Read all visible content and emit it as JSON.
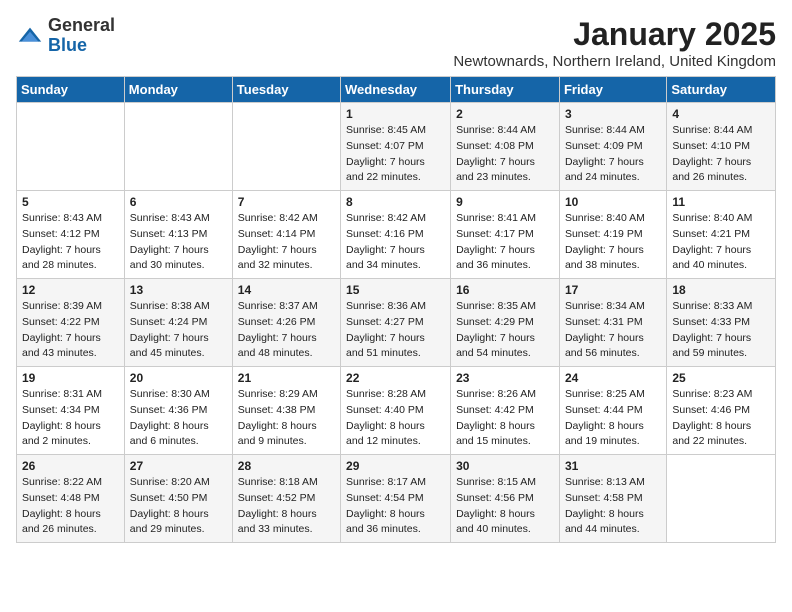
{
  "header": {
    "logo_general": "General",
    "logo_blue": "Blue",
    "month": "January 2025",
    "location": "Newtownards, Northern Ireland, United Kingdom"
  },
  "days_of_week": [
    "Sunday",
    "Monday",
    "Tuesday",
    "Wednesday",
    "Thursday",
    "Friday",
    "Saturday"
  ],
  "weeks": [
    [
      {
        "day": "",
        "info": ""
      },
      {
        "day": "",
        "info": ""
      },
      {
        "day": "",
        "info": ""
      },
      {
        "day": "1",
        "sunrise": "8:45 AM",
        "sunset": "4:07 PM",
        "daylight": "7 hours and 22 minutes."
      },
      {
        "day": "2",
        "sunrise": "8:44 AM",
        "sunset": "4:08 PM",
        "daylight": "7 hours and 23 minutes."
      },
      {
        "day": "3",
        "sunrise": "8:44 AM",
        "sunset": "4:09 PM",
        "daylight": "7 hours and 24 minutes."
      },
      {
        "day": "4",
        "sunrise": "8:44 AM",
        "sunset": "4:10 PM",
        "daylight": "7 hours and 26 minutes."
      }
    ],
    [
      {
        "day": "5",
        "sunrise": "8:43 AM",
        "sunset": "4:12 PM",
        "daylight": "7 hours and 28 minutes."
      },
      {
        "day": "6",
        "sunrise": "8:43 AM",
        "sunset": "4:13 PM",
        "daylight": "7 hours and 30 minutes."
      },
      {
        "day": "7",
        "sunrise": "8:42 AM",
        "sunset": "4:14 PM",
        "daylight": "7 hours and 32 minutes."
      },
      {
        "day": "8",
        "sunrise": "8:42 AM",
        "sunset": "4:16 PM",
        "daylight": "7 hours and 34 minutes."
      },
      {
        "day": "9",
        "sunrise": "8:41 AM",
        "sunset": "4:17 PM",
        "daylight": "7 hours and 36 minutes."
      },
      {
        "day": "10",
        "sunrise": "8:40 AM",
        "sunset": "4:19 PM",
        "daylight": "7 hours and 38 minutes."
      },
      {
        "day": "11",
        "sunrise": "8:40 AM",
        "sunset": "4:21 PM",
        "daylight": "7 hours and 40 minutes."
      }
    ],
    [
      {
        "day": "12",
        "sunrise": "8:39 AM",
        "sunset": "4:22 PM",
        "daylight": "7 hours and 43 minutes."
      },
      {
        "day": "13",
        "sunrise": "8:38 AM",
        "sunset": "4:24 PM",
        "daylight": "7 hours and 45 minutes."
      },
      {
        "day": "14",
        "sunrise": "8:37 AM",
        "sunset": "4:26 PM",
        "daylight": "7 hours and 48 minutes."
      },
      {
        "day": "15",
        "sunrise": "8:36 AM",
        "sunset": "4:27 PM",
        "daylight": "7 hours and 51 minutes."
      },
      {
        "day": "16",
        "sunrise": "8:35 AM",
        "sunset": "4:29 PM",
        "daylight": "7 hours and 54 minutes."
      },
      {
        "day": "17",
        "sunrise": "8:34 AM",
        "sunset": "4:31 PM",
        "daylight": "7 hours and 56 minutes."
      },
      {
        "day": "18",
        "sunrise": "8:33 AM",
        "sunset": "4:33 PM",
        "daylight": "7 hours and 59 minutes."
      }
    ],
    [
      {
        "day": "19",
        "sunrise": "8:31 AM",
        "sunset": "4:34 PM",
        "daylight": "8 hours and 2 minutes."
      },
      {
        "day": "20",
        "sunrise": "8:30 AM",
        "sunset": "4:36 PM",
        "daylight": "8 hours and 6 minutes."
      },
      {
        "day": "21",
        "sunrise": "8:29 AM",
        "sunset": "4:38 PM",
        "daylight": "8 hours and 9 minutes."
      },
      {
        "day": "22",
        "sunrise": "8:28 AM",
        "sunset": "4:40 PM",
        "daylight": "8 hours and 12 minutes."
      },
      {
        "day": "23",
        "sunrise": "8:26 AM",
        "sunset": "4:42 PM",
        "daylight": "8 hours and 15 minutes."
      },
      {
        "day": "24",
        "sunrise": "8:25 AM",
        "sunset": "4:44 PM",
        "daylight": "8 hours and 19 minutes."
      },
      {
        "day": "25",
        "sunrise": "8:23 AM",
        "sunset": "4:46 PM",
        "daylight": "8 hours and 22 minutes."
      }
    ],
    [
      {
        "day": "26",
        "sunrise": "8:22 AM",
        "sunset": "4:48 PM",
        "daylight": "8 hours and 26 minutes."
      },
      {
        "day": "27",
        "sunrise": "8:20 AM",
        "sunset": "4:50 PM",
        "daylight": "8 hours and 29 minutes."
      },
      {
        "day": "28",
        "sunrise": "8:18 AM",
        "sunset": "4:52 PM",
        "daylight": "8 hours and 33 minutes."
      },
      {
        "day": "29",
        "sunrise": "8:17 AM",
        "sunset": "4:54 PM",
        "daylight": "8 hours and 36 minutes."
      },
      {
        "day": "30",
        "sunrise": "8:15 AM",
        "sunset": "4:56 PM",
        "daylight": "8 hours and 40 minutes."
      },
      {
        "day": "31",
        "sunrise": "8:13 AM",
        "sunset": "4:58 PM",
        "daylight": "8 hours and 44 minutes."
      },
      {
        "day": "",
        "info": ""
      }
    ]
  ]
}
